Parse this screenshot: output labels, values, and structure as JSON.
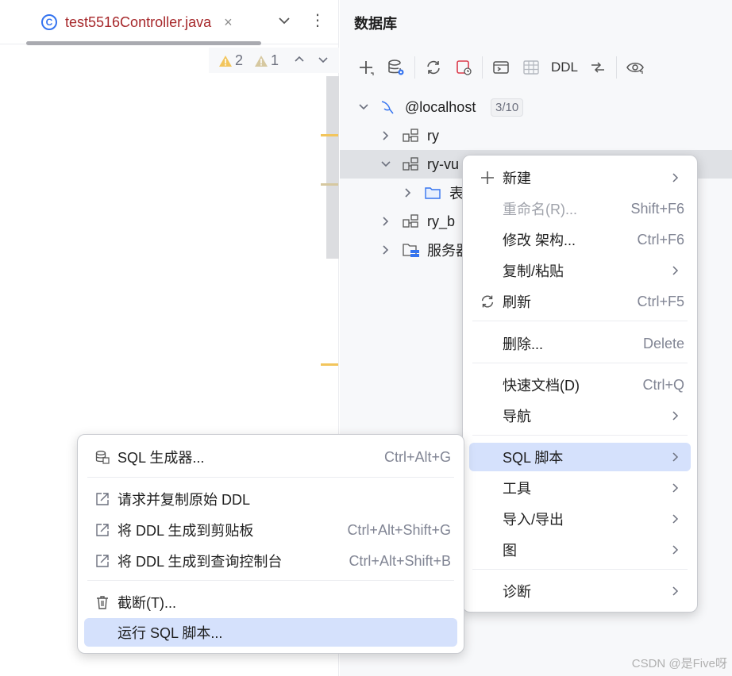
{
  "editor": {
    "tab": {
      "icon_letter": "C",
      "filename": "test5516Controller.java",
      "close": "×"
    },
    "more": "⋮",
    "inspections": {
      "warnings": "2",
      "weak_warnings": "1"
    },
    "colors": {
      "warning_marker": "#f2c55c",
      "weak_marker": "#d6c8a0"
    }
  },
  "db_panel": {
    "title": "数据库",
    "toolbar": {
      "items": [
        "plus-icon",
        "datasource-settings-icon",
        "refresh-icon",
        "stop-icon",
        "console-icon",
        "table-icon",
        "ddl",
        "compare-icon",
        "eye-icon"
      ],
      "ddl_label": "DDL"
    },
    "tree": [
      {
        "label": "@localhost",
        "badge": "3/10",
        "icon": "mysql-dolphin-icon",
        "expanded": true
      },
      {
        "label": "ry",
        "icon": "schema-icon",
        "expanded": false
      },
      {
        "label": "ry-vu",
        "icon": "schema-icon",
        "expanded": true,
        "selected": true
      },
      {
        "label": "表",
        "icon": "folder-icon",
        "expanded": false
      },
      {
        "label": "ry_b",
        "icon": "schema-icon",
        "expanded": false
      },
      {
        "label": "服务器",
        "icon": "server-objects-icon",
        "expanded": false
      }
    ]
  },
  "context_menu": {
    "items": [
      {
        "label": "新建",
        "submenu": true,
        "icon": "plus-icon"
      },
      {
        "label": "重命名(R)...",
        "shortcut": "Shift+F6",
        "disabled": true
      },
      {
        "label": "修改 架构...",
        "shortcut": "Ctrl+F6"
      },
      {
        "label": "复制/粘贴",
        "submenu": true
      },
      {
        "label": "刷新",
        "shortcut": "Ctrl+F5",
        "icon": "refresh-icon"
      },
      {
        "label": "删除...",
        "shortcut": "Delete"
      },
      {
        "label": "快速文档(D)",
        "shortcut": "Ctrl+Q"
      },
      {
        "label": "导航",
        "submenu": true
      },
      {
        "label": "SQL 脚本",
        "submenu": true,
        "highlighted": true
      },
      {
        "label": "工具",
        "submenu": true
      },
      {
        "label": "导入/导出",
        "submenu": true
      },
      {
        "label": "图",
        "submenu": true
      },
      {
        "label": "诊断",
        "submenu": true
      }
    ]
  },
  "sql_submenu": {
    "items": [
      {
        "label": "SQL 生成器...",
        "shortcut": "Ctrl+Alt+G",
        "icon": "sql-generator-icon"
      },
      {
        "label": "请求并复制原始 DDL",
        "icon": "external-link-icon"
      },
      {
        "label": "将 DDL 生成到剪贴板",
        "shortcut": "Ctrl+Alt+Shift+G",
        "icon": "external-link-icon"
      },
      {
        "label": "将 DDL 生成到查询控制台",
        "shortcut": "Ctrl+Alt+Shift+B",
        "icon": "external-link-icon"
      },
      {
        "label": "截断(T)...",
        "icon": "trash-icon"
      },
      {
        "label": "运行 SQL 脚本...",
        "highlighted": true
      }
    ]
  },
  "watermark": "CSDN @是Five呀"
}
